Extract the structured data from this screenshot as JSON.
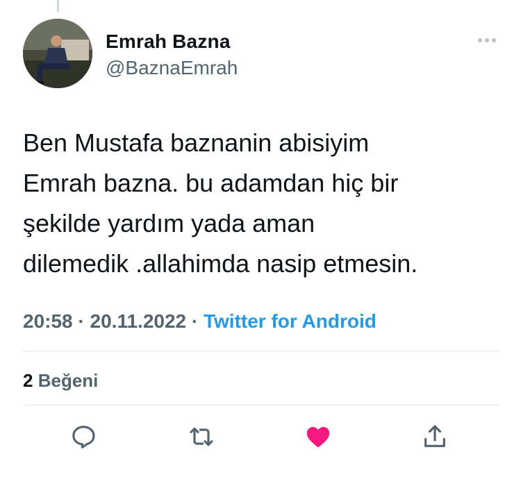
{
  "author": {
    "name": "Emrah Bazna",
    "handle": "@BaznaEmrah"
  },
  "tweet": {
    "text": "Ben Mustafa baznanin abisiyim\nEmrah bazna.  bu adamdan hiç bir\nşekilde yardım yada aman\ndilemedik .allahimda nasip etmesin."
  },
  "meta": {
    "time": "20:58",
    "separator": " · ",
    "date": "20.11.2022",
    "source": "Twitter for Android"
  },
  "engagement": {
    "like_count": "2",
    "like_label": "Beğeni"
  },
  "actions": [
    {
      "icon": "reply-icon"
    },
    {
      "icon": "retweet-icon"
    },
    {
      "icon": "heart-icon",
      "state": "liked",
      "color": "#f91880"
    },
    {
      "icon": "share-icon"
    }
  ],
  "colors": {
    "link": "#1d9bf0",
    "secondary_text": "#536471",
    "like": "#f91880"
  }
}
